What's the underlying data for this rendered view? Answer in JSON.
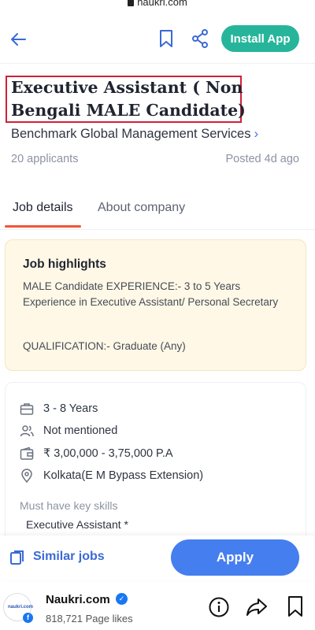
{
  "browser": {
    "url": "naukri.com"
  },
  "header": {
    "install_label": "Install App"
  },
  "job": {
    "title": "Executive Assistant ( Non Bengali MALE Candidate)",
    "company": "Benchmark Global Management Services",
    "applicants": "20 applicants",
    "posted": "Posted 4d ago"
  },
  "tabs": [
    {
      "label": "Job details",
      "active": true
    },
    {
      "label": "About company",
      "active": false
    }
  ],
  "highlights": {
    "title": "Job highlights",
    "experience": "MALE Candidate EXPERIENCE:- 3 to 5 Years Experience in Executive Assistant/ Personal Secretary",
    "qualification": "QUALIFICATION:- Graduate (Any)"
  },
  "details": {
    "experience": "3 - 8 Years",
    "openings": "Not mentioned",
    "salary": "₹ 3,00,000 - 3,75,000 P.A",
    "location": "Kolkata(E M Bypass Extension)",
    "skills_label": "Must have key skills",
    "skills": [
      "Executive Assistant *"
    ]
  },
  "actions": {
    "similar_label": "Similar jobs",
    "apply_label": "Apply"
  },
  "facebook": {
    "page_name": "Naukri.com",
    "likes": "818,721 Page likes",
    "avatar_text": "naukri.com"
  },
  "colors": {
    "accent_green": "#26b59b",
    "apply_blue": "#457eef",
    "link_blue": "#3a6ad6",
    "tab_underline": "#f05537",
    "highlight_bg": "#fff8e6",
    "title_border": "#d1203a"
  }
}
